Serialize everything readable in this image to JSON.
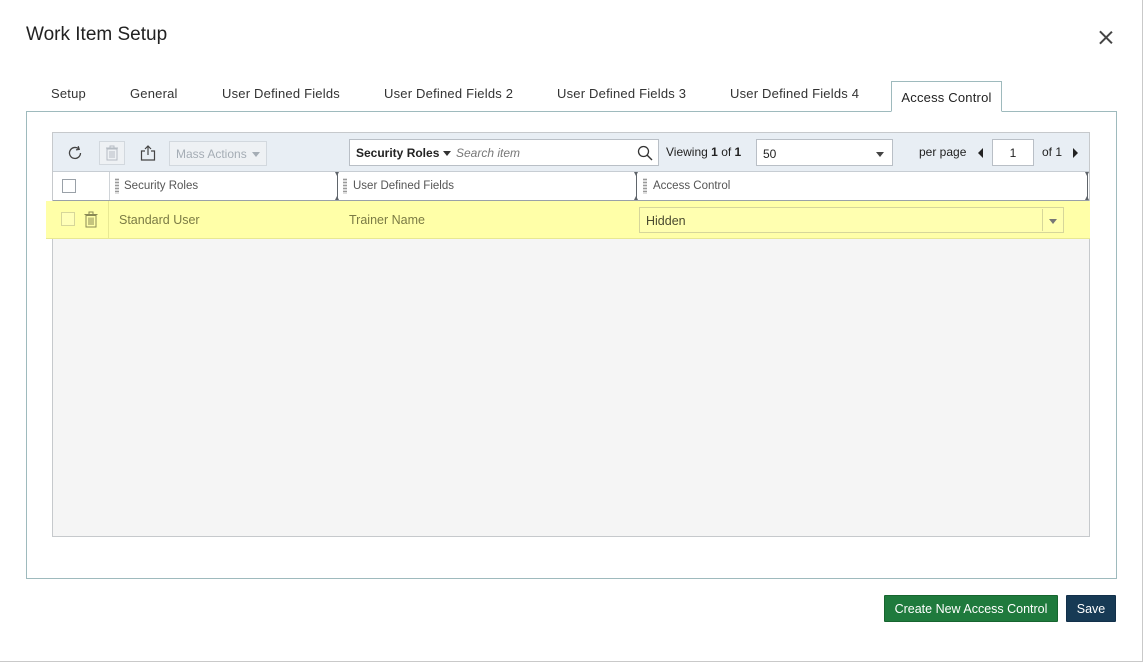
{
  "dialog": {
    "title": "Work Item Setup"
  },
  "tabs": [
    {
      "label": "Setup"
    },
    {
      "label": "General"
    },
    {
      "label": "User Defined Fields"
    },
    {
      "label": "User Defined Fields 2"
    },
    {
      "label": "User Defined Fields 3"
    },
    {
      "label": "User Defined Fields 4"
    },
    {
      "label": "Access Control",
      "active": true
    }
  ],
  "toolbar": {
    "refresh_icon": "refresh-icon",
    "delete_icon": "trash-icon",
    "export_icon": "export-icon",
    "mass_actions_label": "Mass Actions",
    "search_filter_label": "Security Roles",
    "search_placeholder": "Search item",
    "viewing_prefix": "Viewing",
    "viewing_current": "1",
    "viewing_of": "of",
    "viewing_total": "1",
    "page_size": "50",
    "per_page_label": "per page",
    "page_number": "1",
    "of_pages": "of 1"
  },
  "grid": {
    "columns": [
      "Security Roles",
      "User Defined Fields",
      "Access Control"
    ],
    "rows": [
      {
        "security_role": "Standard User",
        "user_defined_field": "Trainer Name",
        "access_control": "Hidden"
      }
    ]
  },
  "footer": {
    "create_label": "Create New Access Control",
    "save_label": "Save"
  },
  "colors": {
    "create_button": "#1f7a3d",
    "save_button": "#173a55",
    "selected_row": "#ffffa8",
    "toolbar": "#e8eef4"
  }
}
